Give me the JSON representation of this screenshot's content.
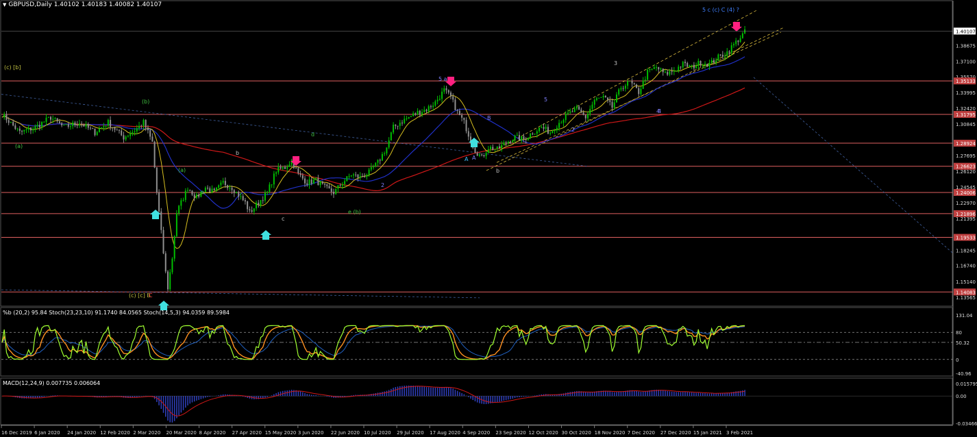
{
  "header": {
    "symbol_line": "GBPUSD,Daily  1.40102 1.40183 1.40082 1.40107",
    "indicator1_line": "%b (20,2) 95.84  Stoch(23,23,10) 91.1740 84.0565  Stoch(14,5,3) 94.0359 89.5984",
    "indicator2_line": "MACD(12,24,9) 0.007735 0.006064"
  },
  "colors": {
    "background": "#000000",
    "bull_candle": "#00c000",
    "bear_candle": "#909090",
    "horizontal_levels": "#e06060",
    "ma_long": "#d01818",
    "ma_mid": "#2030c8",
    "ma_fast": "#d8c020",
    "channel": "#e0c040",
    "stoch_green": "#a0ff30",
    "stoch_orange": "#ff9020",
    "macd_hist": "#3040c0",
    "macd_signal": "#d01818",
    "arrow_down": "#ff2080",
    "arrow_up": "#40e0e0"
  },
  "chart_data": {
    "type": "candlestick",
    "price_axis": {
      "ylim": [
        1.1335,
        1.4225
      ],
      "ticks": [
        "1.38675",
        "1.37100",
        "1.35570",
        "1.33995",
        "1.32420",
        "1.30845",
        "1.27695",
        "1.26120",
        "1.24545",
        "1.22970",
        "1.21395",
        "1.18245",
        "1.16740",
        "1.15140",
        "1.13565"
      ],
      "current_price": "1.40107",
      "level_labels": [
        "1.35133",
        "1.31795",
        "1.28924",
        "1.26623",
        "1.24006",
        "1.21896",
        "1.19533",
        "1.14083"
      ],
      "levels": [
        1.35133,
        1.31795,
        1.28924,
        1.26623,
        1.24006,
        1.21896,
        1.19533,
        1.14083
      ]
    },
    "x_ticks": [
      "16 Dec 2019",
      "6 Jan 2020",
      "24 Jan 2020",
      "12 Feb 2020",
      "2 Mar 2020",
      "20 Mar 2020",
      "8 Apr 2020",
      "27 Apr 2020",
      "15 May 2020",
      "3 Jun 2020",
      "22 Jun 2020",
      "10 Jul 2020",
      "29 Jul 2020",
      "17 Aug 2020",
      "4 Sep 2020",
      "23 Sep 2020",
      "12 Oct 2020",
      "30 Oct 2020",
      "18 Nov 2020",
      "7 Dec 2020",
      "27 Dec 2020",
      "15 Jan 2021",
      "3 Feb 2021"
    ],
    "close_path": [
      [
        0,
        1.318
      ],
      [
        8,
        1.3
      ],
      [
        15,
        1.305
      ],
      [
        22,
        1.315
      ],
      [
        28,
        1.305
      ],
      [
        35,
        1.31
      ],
      [
        42,
        1.3
      ],
      [
        48,
        1.31
      ],
      [
        55,
        1.295
      ],
      [
        60,
        1.302
      ],
      [
        64,
        1.31
      ],
      [
        68,
        1.29
      ],
      [
        70,
        1.24
      ],
      [
        72,
        1.2
      ],
      [
        74,
        1.16
      ],
      [
        75,
        1.145
      ],
      [
        77,
        1.175
      ],
      [
        79,
        1.22
      ],
      [
        81,
        1.23
      ],
      [
        84,
        1.245
      ],
      [
        88,
        1.235
      ],
      [
        92,
        1.245
      ],
      [
        96,
        1.24
      ],
      [
        100,
        1.25
      ],
      [
        104,
        1.245
      ],
      [
        108,
        1.235
      ],
      [
        110,
        1.23
      ],
      [
        112,
        1.22
      ],
      [
        116,
        1.23
      ],
      [
        120,
        1.24
      ],
      [
        124,
        1.262
      ],
      [
        128,
        1.265
      ],
      [
        131,
        1.272
      ],
      [
        134,
        1.258
      ],
      [
        138,
        1.25
      ],
      [
        142,
        1.252
      ],
      [
        146,
        1.245
      ],
      [
        150,
        1.24
      ],
      [
        154,
        1.25
      ],
      [
        158,
        1.258
      ],
      [
        162,
        1.255
      ],
      [
        166,
        1.26
      ],
      [
        170,
        1.27
      ],
      [
        174,
        1.285
      ],
      [
        177,
        1.305
      ],
      [
        180,
        1.31
      ],
      [
        184,
        1.315
      ],
      [
        188,
        1.32
      ],
      [
        192,
        1.323
      ],
      [
        196,
        1.33
      ],
      [
        200,
        1.342
      ],
      [
        203,
        1.335
      ],
      [
        206,
        1.32
      ],
      [
        209,
        1.31
      ],
      [
        212,
        1.292
      ],
      [
        214,
        1.282
      ],
      [
        217,
        1.275
      ],
      [
        220,
        1.285
      ],
      [
        224,
        1.283
      ],
      [
        228,
        1.29
      ],
      [
        232,
        1.295
      ],
      [
        236,
        1.293
      ],
      [
        240,
        1.3
      ],
      [
        244,
        1.305
      ],
      [
        248,
        1.3
      ],
      [
        252,
        1.31
      ],
      [
        256,
        1.318
      ],
      [
        260,
        1.323
      ],
      [
        264,
        1.315
      ],
      [
        268,
        1.332
      ],
      [
        272,
        1.335
      ],
      [
        276,
        1.325
      ],
      [
        280,
        1.345
      ],
      [
        284,
        1.35
      ],
      [
        288,
        1.34
      ],
      [
        292,
        1.36
      ],
      [
        296,
        1.365
      ],
      [
        300,
        1.358
      ],
      [
        304,
        1.362
      ],
      [
        308,
        1.368
      ],
      [
        312,
        1.365
      ],
      [
        316,
        1.37
      ],
      [
        320,
        1.368
      ],
      [
        324,
        1.375
      ],
      [
        328,
        1.38
      ],
      [
        332,
        1.39
      ],
      [
        336,
        1.4
      ]
    ],
    "wave_labels": [
      "(c) [b]",
      "(a)",
      "(b)",
      "(a)",
      "b",
      "d",
      "A",
      "a",
      "c",
      "e (b)",
      "5 a",
      "B",
      "5",
      "A",
      "4",
      "3",
      "2",
      "4",
      "5 c (c) C (4) ?",
      "(c) [c] B",
      "C",
      "b",
      "2"
    ],
    "osc_axis": {
      "ticks": [
        "131.04",
        "80",
        "50.32",
        "0",
        "-40.96"
      ]
    },
    "macd_axis": {
      "ticks": [
        "0.015795",
        "0.00",
        "-0.034665"
      ]
    },
    "macd": {
      "zero_line": 0.0,
      "ylim": [
        -0.034665,
        0.015795
      ]
    }
  }
}
